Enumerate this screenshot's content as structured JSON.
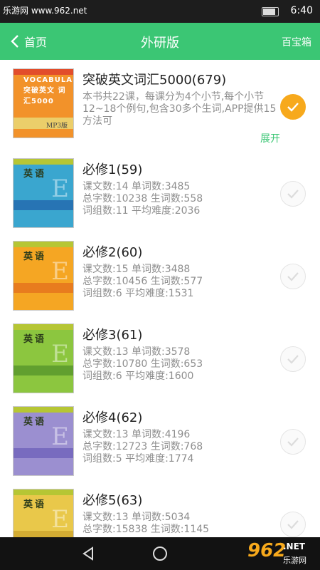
{
  "status": {
    "watermark": "乐游网 www.962.net",
    "time": "6:40"
  },
  "header": {
    "back_label": "首页",
    "title": "外研版",
    "right_button": "百宝箱"
  },
  "books": [
    {
      "name": "突破英文词汇5000(679)",
      "desc": "本书共22课，每课分为4个小节,每个小节12~18个例句,包含30多个生词,APP提供15方法可",
      "expand": "展开",
      "selected": true,
      "cover_color": "#f2922a",
      "cover_text": "VOCABULARY 突破英文 词汇5000",
      "cover_brand": "MP3版"
    },
    {
      "name": "必修1(59)",
      "desc": "课文数:14 单词数:3485\n总字数:10238 生词数:558\n词组数:11 平均难度:2036",
      "selected": false,
      "cover_color": "#3aa6cf",
      "cover_text": "英语"
    },
    {
      "name": "必修2(60)",
      "desc": "课文数:15 单词数:3488\n总字数:10456 生词数:577\n词组数:6 平均难度:1531",
      "selected": false,
      "cover_color": "#f5a623",
      "cover_text": "英语"
    },
    {
      "name": "必修3(61)",
      "desc": "课文数:13 单词数:3578\n总字数:10780 生词数:653\n词组数:6 平均难度:1600",
      "selected": false,
      "cover_color": "#8cc63f",
      "cover_text": "英语"
    },
    {
      "name": "必修4(62)",
      "desc": "课文数:13 单词数:4196\n总字数:12723 生词数:768\n词组数:5 平均难度:1774",
      "selected": false,
      "cover_color": "#9b8fd0",
      "cover_text": "英语"
    },
    {
      "name": "必修5(63)",
      "desc": "课文数:13 单词数:5034\n总字数:15838 生词数:1145",
      "selected": false,
      "cover_color": "#e9c84a",
      "cover_text": "英语"
    }
  ],
  "navbar": {
    "logo_number": "962",
    "logo_suffix": ".NET",
    "logo_cn": "乐游网"
  }
}
